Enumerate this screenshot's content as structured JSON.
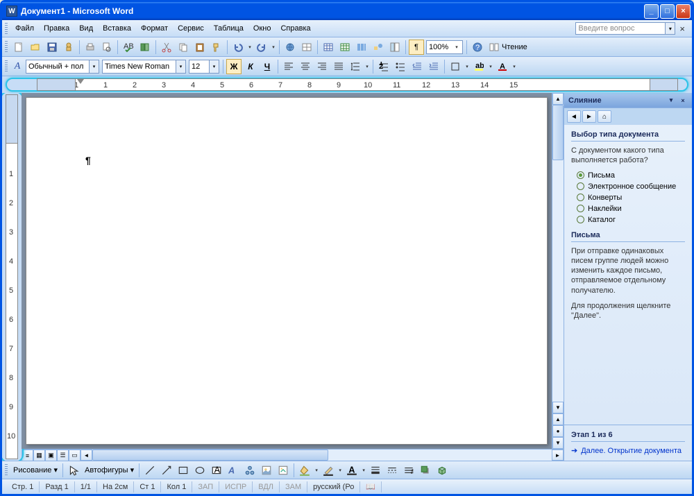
{
  "titlebar": {
    "title": "Документ1 - Microsoft Word"
  },
  "menu": {
    "file": "Файл",
    "edit": "Правка",
    "view": "Вид",
    "insert": "Вставка",
    "format": "Формат",
    "tools": "Сервис",
    "table": "Таблица",
    "window": "Окно",
    "help": "Справка",
    "help_placeholder": "Введите вопрос"
  },
  "toolbar": {
    "zoom": "100%",
    "reading": "Чтение"
  },
  "format": {
    "style": "Обычный + пол",
    "font": "Times New Roman",
    "size": "12",
    "bold": "Ж",
    "italic": "К",
    "underline": "Ч"
  },
  "taskpane": {
    "title": "Слияние",
    "section1_title": "Выбор типа документа",
    "section1_question": "С документом какого типа выполняется работа?",
    "options": {
      "letters": "Письма",
      "email": "Электронное сообщение",
      "envelopes": "Конверты",
      "labels": "Наклейки",
      "catalog": "Каталог"
    },
    "section2_title": "Письма",
    "section2_text": "При отправке одинаковых писем группе людей можно изменить каждое письмо, отправляемое отдельному получателю.",
    "section2_text2": "Для продолжения щелкните \"Далее\".",
    "step_label": "Этап 1 из 6",
    "next_link": "Далее. Открытие документа"
  },
  "drawbar": {
    "drawing": "Рисование",
    "autoshapes": "Автофигуры"
  },
  "status": {
    "page": "Стр. 1",
    "section": "Разд 1",
    "pages": "1/1",
    "at": "На 2см",
    "line": "Ст 1",
    "col": "Кол 1",
    "rec": "ЗАП",
    "trk": "ИСПР",
    "ext": "ВДЛ",
    "ovr": "ЗАМ",
    "lang": "русский (Ро"
  }
}
